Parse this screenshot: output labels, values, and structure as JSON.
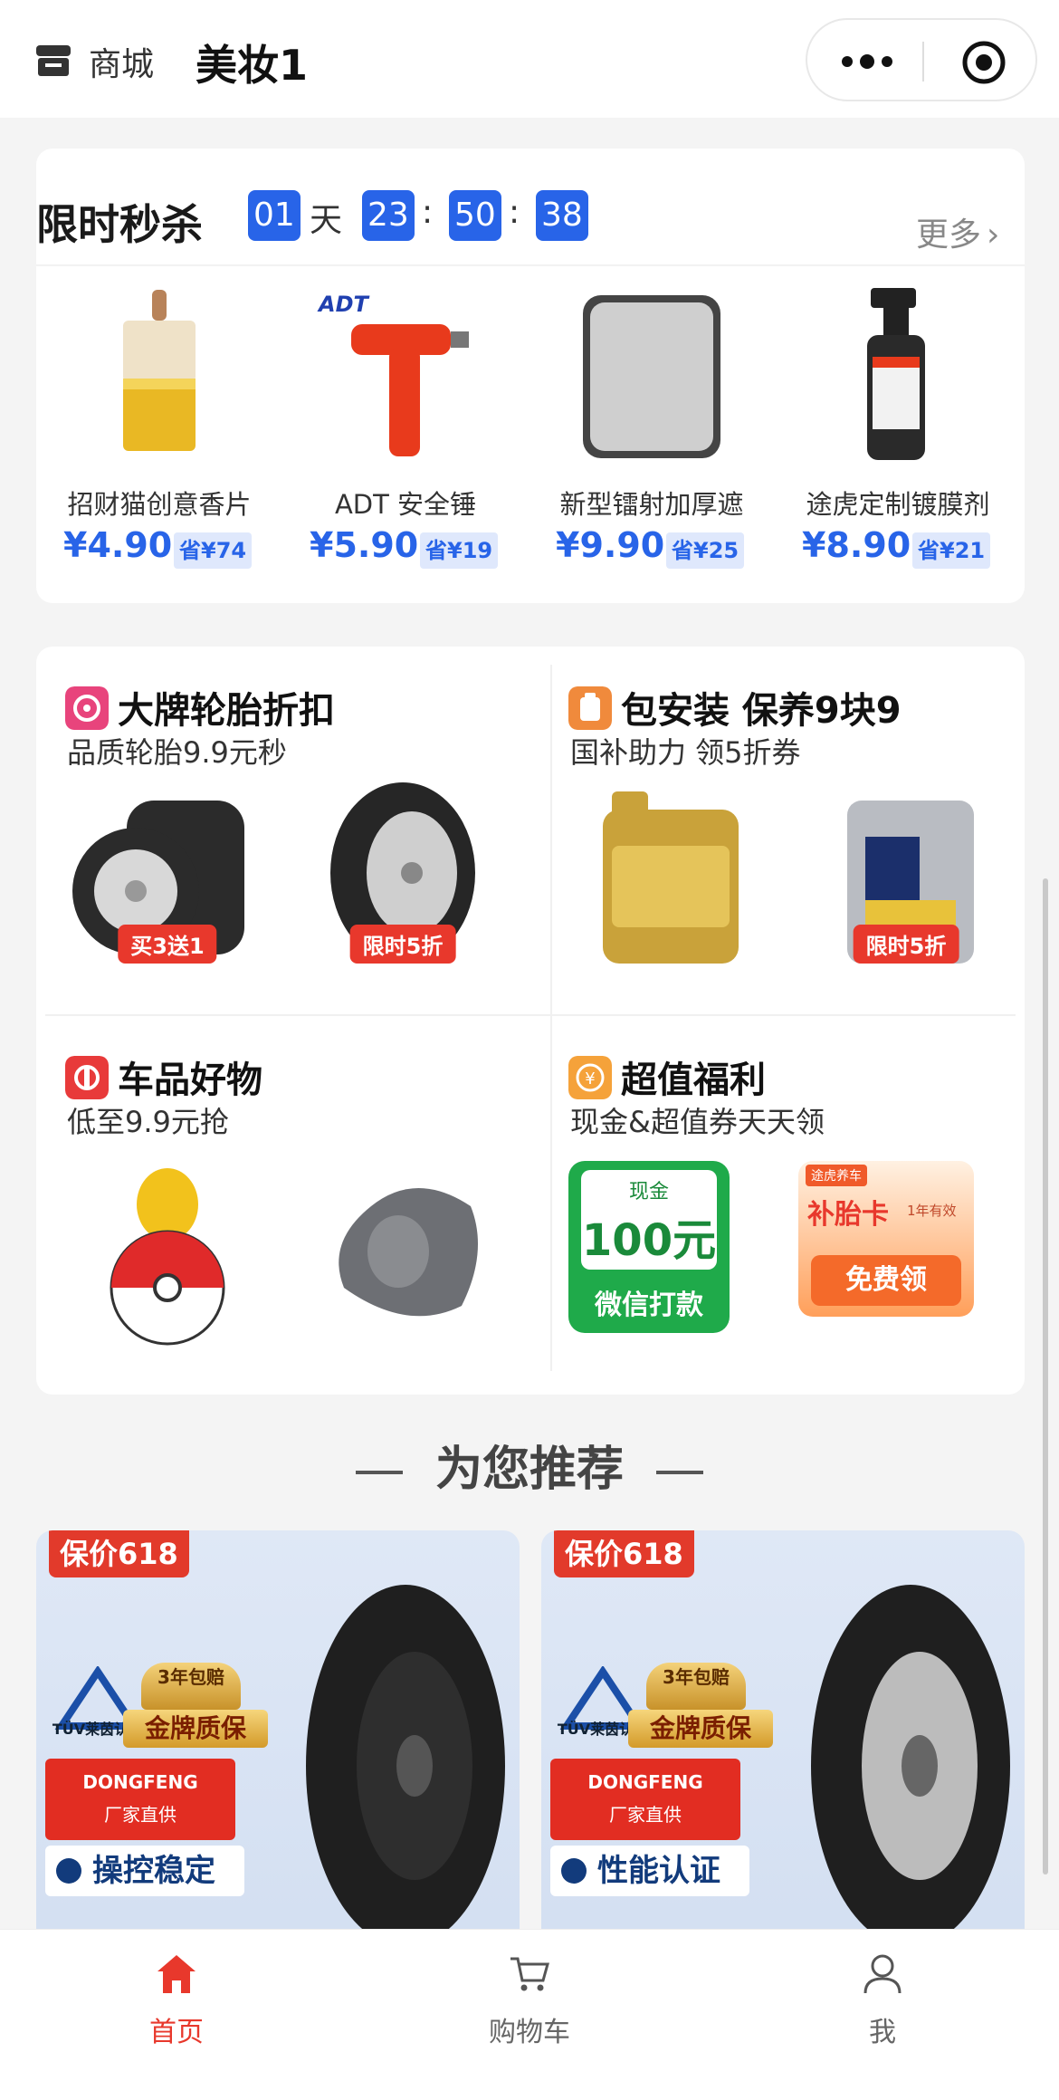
{
  "header": {
    "store_label": "商城",
    "title": "美妆1"
  },
  "flash_sale": {
    "title": "限时秒杀",
    "countdown": {
      "days": "01",
      "day_unit": "天",
      "hours": "23",
      "minutes": "50",
      "seconds": "38",
      "sep": ":"
    },
    "more_label": "更多",
    "products": [
      {
        "name": "招财猫创意香片",
        "price": "¥4.90",
        "save": "省¥74",
        "icon": "perfume-bottle-icon"
      },
      {
        "name": "ADT 安全锤",
        "price": "¥5.90",
        "save": "省¥19",
        "icon": "safety-hammer-icon"
      },
      {
        "name": "新型镭射加厚遮",
        "price": "¥9.90",
        "save": "省¥25",
        "icon": "sunshade-icon"
      },
      {
        "name": "途虎定制镀膜剂",
        "price": "¥8.90",
        "save": "省¥21",
        "icon": "spray-bottle-icon"
      }
    ]
  },
  "categories": [
    {
      "title": "大牌轮胎折扣",
      "subtitle": "品质轮胎9.9元秒",
      "icon_color": "#e8447c",
      "tags": [
        "买3送1",
        "限时5折"
      ]
    },
    {
      "title": "包安装 保养9块9",
      "subtitle": "国补助力 领5折券",
      "icon_color": "#f08a3c",
      "tags": [
        "",
        "限时5折"
      ]
    },
    {
      "title": "车品好物",
      "subtitle": "低至9.9元抢",
      "icon_color": "#e83a3a",
      "tags": [
        "",
        ""
      ]
    },
    {
      "title": "超值福利",
      "subtitle": "现金&超值券天天领",
      "icon_color": "#f5a23a",
      "cash_card": {
        "top": "现金",
        "amount": "100元",
        "bottom": "微信打款"
      },
      "tire_card": {
        "brand": "途虎养车",
        "title": "补胎卡",
        "validity": "1年有效",
        "bottom": "免费领"
      }
    }
  ],
  "recommend": {
    "title": "为您推荐",
    "items": [
      {
        "badge": "保价618",
        "tuv": "TÜV莱茵认证",
        "gold_top": "3年包赔",
        "gold_bottom": "金牌质保",
        "brand": "DONGFENG",
        "brand_sub": "厂家直供",
        "feature": "操控稳定"
      },
      {
        "badge": "保价618",
        "tuv": "TÜV莱茵认证",
        "gold_top": "3年包赔",
        "gold_bottom": "金牌质保",
        "brand": "DONGFENG",
        "brand_sub": "厂家直供",
        "feature": "性能认证"
      }
    ]
  },
  "tabbar": {
    "tabs": [
      {
        "label": "首页",
        "active": true
      },
      {
        "label": "购物车",
        "active": false
      },
      {
        "label": "我",
        "active": false
      }
    ],
    "active_color": "#e8382c"
  },
  "colors": {
    "accent_blue": "#2864e8",
    "accent_red": "#e8382c"
  }
}
